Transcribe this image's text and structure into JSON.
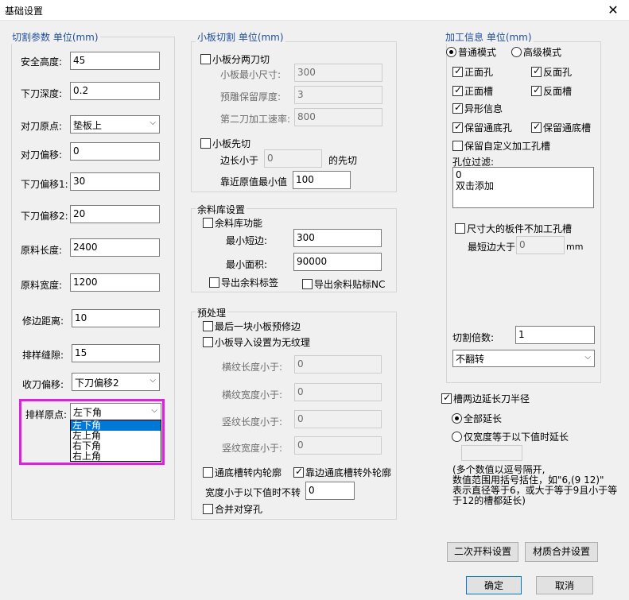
{
  "window": {
    "title": "基础设置",
    "close": "✕"
  },
  "cut_params": {
    "legend": "切割参数 单位(mm)",
    "fields": [
      {
        "label": "安全高度:",
        "value": "45"
      },
      {
        "label": "下刀深度:",
        "value": "0.2"
      },
      {
        "label": "对刀原点:",
        "value": "垫板上"
      },
      {
        "label": "对刀偏移:",
        "value": "0"
      },
      {
        "label": "下刀偏移1:",
        "value": "30"
      },
      {
        "label": "下刀偏移2:",
        "value": "20"
      },
      {
        "label": "原料长度:",
        "value": "2400"
      },
      {
        "label": "原料宽度:",
        "value": "1200"
      },
      {
        "label": "修边距离:",
        "value": "10"
      },
      {
        "label": "排样缝隙:",
        "value": "15"
      },
      {
        "label": "收刀偏移:",
        "value": "下刀偏移2"
      },
      {
        "label": "排样原点:",
        "value": "左下角"
      }
    ],
    "origin_options": [
      "左下角",
      "左上角",
      "右下角",
      "右上角"
    ]
  },
  "small_board": {
    "legend": "小板切割 单位(mm)",
    "split_two": "小板分两刀切",
    "min_size_label": "小板最小尺寸:",
    "min_size": "300",
    "reserve_label": "预雕保留厚度:",
    "reserve": "3",
    "speed_label": "第二刀加工速率:",
    "speed": "800",
    "cut_first": "小板先切",
    "edge_less": "边长小于",
    "edge_value": "0",
    "edge_suffix": "的先切",
    "near_origin": "靠近原值最小值",
    "near_value": "100"
  },
  "remnant": {
    "legend": "余料库设置",
    "enable": "余料库功能",
    "min_short_label": "最小短边:",
    "min_short": "300",
    "min_area_label": "最小面积:",
    "min_area": "90000",
    "export_label": "导出余料标签",
    "export_nc": "导出余料贴标NC"
  },
  "preprocess": {
    "legend": "预处理",
    "last_trim": "最后一块小板预修边",
    "no_texture": "小板导入设置为无纹理",
    "h_len_label": "横纹长度小于:",
    "h_len": "0",
    "h_wid_label": "横纹宽度小于:",
    "h_wid": "0",
    "v_len_label": "竖纹长度小于:",
    "v_len": "0",
    "v_wid_label": "竖纹宽度小于:",
    "v_wid": "0",
    "slot_inner": "通底槽转内轮廓",
    "slot_outer": "靠边通底槽转外轮廓",
    "width_less": "宽度小于以下值时不转",
    "width_value": "0",
    "merge_holes": "合并对穿孔"
  },
  "process_info": {
    "legend": "加工信息 单位(mm)",
    "mode_normal": "普通模式",
    "mode_advanced": "高级模式",
    "front_hole": "正面孔",
    "back_hole": "反面孔",
    "front_slot": "正面槽",
    "back_slot": "反面槽",
    "shaped": "异形信息",
    "keep_through_hole": "保留通底孔",
    "keep_through_slot": "保留通底槽",
    "keep_custom": "保留自定义加工孔槽",
    "hole_filter": "孔位过滤:",
    "filter_lines": [
      "0",
      "双击添加"
    ],
    "oversize": "尺寸大的板件不加工孔槽",
    "shortest_label": "最短边大于",
    "shortest_value": "0",
    "shortest_unit": "mm",
    "multiple_label": "切割倍数:",
    "multiple": "1",
    "flip": "不翻转"
  },
  "slot_extend": {
    "title": "槽两边延长刀半径",
    "all": "全部延长",
    "width_only": "仅宽度等于以下值时延长",
    "note": [
      "(多个数值以逗号隔开,",
      "数值范围用括号括住，如\"6,(9 12)\"",
      "表示直径等于6，或大于等于9且小于等",
      "于12的槽都延长)"
    ]
  },
  "buttons": {
    "secondary": "二次开料设置",
    "material_merge": "材质合并设置",
    "ok": "确定",
    "cancel": "取消"
  }
}
